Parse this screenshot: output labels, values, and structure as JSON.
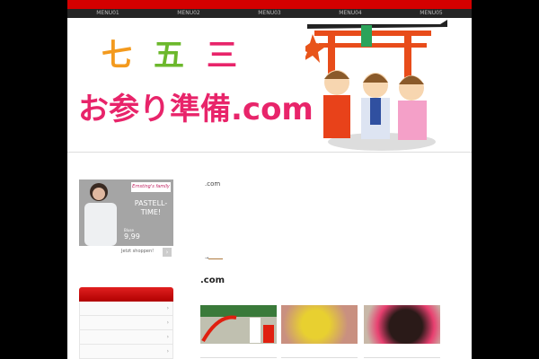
{
  "menu": [
    "MENU01",
    "MENU02",
    "MENU03",
    "MENU04",
    "MENU05"
  ],
  "logo": {
    "k1": "七",
    "k2": "五",
    "k3": "三",
    "subtitle": "お参り準備.com",
    "colors": {
      "k1": "#f39a1e",
      "k2": "#6cb82c",
      "k3": "#e8246a"
    }
  },
  "ad": {
    "brand": "Ernsting's family",
    "headline": "PASTELL-TIME!",
    "product": "Bluse",
    "price": "9,99",
    "cta": "Jetzt shoppen!",
    "cta_icon": "chevron-right"
  },
  "widget": {
    "items": [
      "›",
      "›",
      "›",
      "›"
    ]
  },
  "main": {
    "intro": ".com",
    "more_link": "→",
    "section_title": ".com"
  }
}
